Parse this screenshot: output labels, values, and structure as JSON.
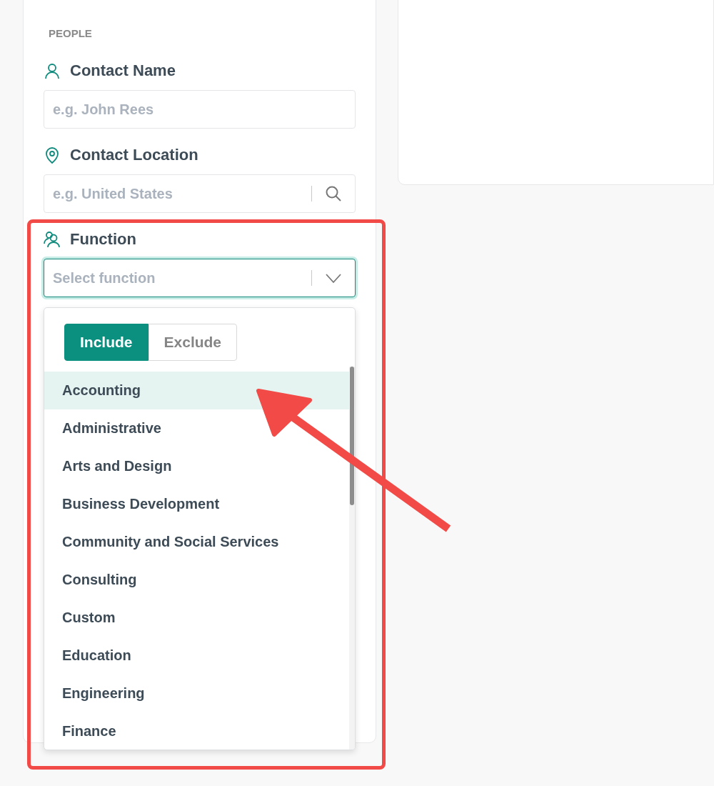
{
  "section": {
    "heading": "PEOPLE"
  },
  "fields": [
    {
      "kind": "text",
      "label": "Contact Name",
      "placeholder": "e.g. John Rees"
    },
    {
      "kind": "search",
      "label": "Contact Location",
      "placeholder": "e.g. United States"
    },
    {
      "kind": "select",
      "label": "Function",
      "placeholder": "Select function",
      "focused": true,
      "expanded": true
    }
  ],
  "dropdown": {
    "toggle": [
      {
        "label": "Include",
        "selected": true
      },
      {
        "label": "Exclude",
        "selected": false
      }
    ],
    "options": [
      {
        "label": "Accounting",
        "highlighted": true
      },
      {
        "label": "Administrative",
        "highlighted": false
      },
      {
        "label": "Arts and Design",
        "highlighted": false
      },
      {
        "label": "Business Development",
        "highlighted": false
      },
      {
        "label": "Community and Social Services",
        "highlighted": false
      },
      {
        "label": "Consulting",
        "highlighted": false
      },
      {
        "label": "Custom",
        "highlighted": false
      },
      {
        "label": "Education",
        "highlighted": false
      },
      {
        "label": "Engineering",
        "highlighted": false
      },
      {
        "label": "Finance",
        "highlighted": false
      }
    ]
  }
}
